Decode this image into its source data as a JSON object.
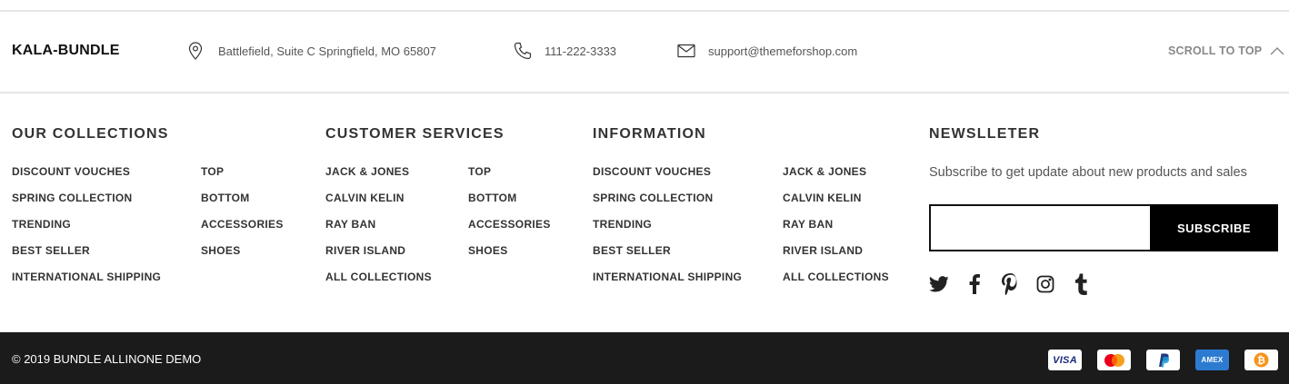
{
  "header": {
    "brand": "KALA-BUNDLE",
    "address": "Battlefield, Suite C Springfield, MO 65807",
    "phone": "111-222-3333",
    "email": "support@themeforshop.com",
    "scroll_top_label": "SCROLL TO TOP",
    "icons": {
      "address": "map-pin-icon",
      "phone": "phone-icon",
      "email": "envelope-icon",
      "scroll": "chevron-up-icon"
    }
  },
  "columns": {
    "collections": {
      "title": "OUR COLLECTIONS",
      "list_a": [
        "DISCOUNT VOUCHES",
        "SPRING COLLECTION",
        "TRENDING",
        "BEST SELLER",
        "INTERNATIONAL SHIPPING"
      ],
      "list_b": [
        "TOP",
        "BOTTOM",
        "ACCESSORIES",
        "SHOES"
      ]
    },
    "services": {
      "title": "CUSTOMER SERVICES",
      "list_a": [
        "JACK & JONES",
        "CALVIN KELIN",
        "RAY BAN",
        "RIVER ISLAND",
        "ALL COLLECTIONS"
      ],
      "list_b": [
        "TOP",
        "BOTTOM",
        "ACCESSORIES",
        "SHOES"
      ]
    },
    "information": {
      "title": "INFORMATION",
      "list_a": [
        "DISCOUNT VOUCHES",
        "SPRING COLLECTION",
        "TRENDING",
        "BEST SELLER",
        "INTERNATIONAL SHIPPING"
      ],
      "list_b": [
        "JACK & JONES",
        "CALVIN KELIN",
        "RAY BAN",
        "RIVER ISLAND",
        "ALL COLLECTIONS"
      ]
    },
    "newsletter": {
      "title": "NEWSLLETER",
      "text": "Subscribe to get update about new products and sales",
      "input_value": "",
      "input_placeholder": "",
      "button_label": "SUBSCRIBE",
      "social": [
        "twitter-icon",
        "facebook-icon",
        "pinterest-icon",
        "instagram-icon",
        "tumblr-icon"
      ]
    }
  },
  "footer": {
    "copyright": "© 2019 BUNDLE ALLINONE DEMO",
    "payments": [
      "visa-card-icon",
      "mastercard-icon",
      "paypal-icon",
      "amex-card-icon",
      "bitcoin-icon"
    ],
    "visa_text": "VISA",
    "amex_text": "AMEX"
  },
  "colors": {
    "bottom_bar": "#1b1b1b",
    "button_bg": "#000000",
    "muted": "#888888",
    "mastercard_red": "#eb001b",
    "mastercard_orange": "#f79e1b",
    "paypal_navy": "#253b80",
    "paypal_blue": "#179bd7",
    "amex_blue": "#2d7bd1",
    "bitcoin_orange": "#f7931a"
  }
}
